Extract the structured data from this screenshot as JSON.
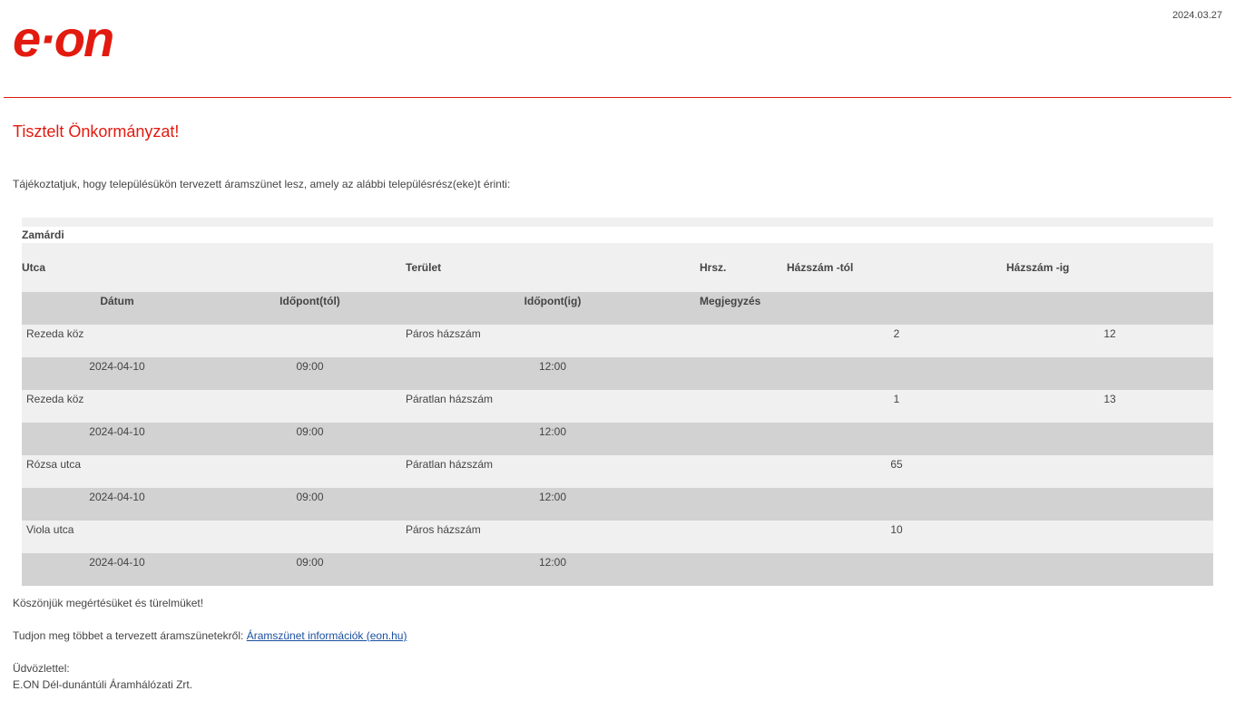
{
  "brand": {
    "logo_text": "e·on",
    "accent_color": "#e31a0f"
  },
  "date": "2024.03.27",
  "greeting": "Tisztelt Önkormányzat!",
  "intro": "Tájékoztatjuk, hogy településükön tervezett áramszünet lesz, amely az alábbi településrész(eke)t érinti:",
  "table": {
    "settlement": "Zamárdi",
    "headers_row1": {
      "utca": "Utca",
      "terulet": "Terület",
      "hrsz": "Hrsz.",
      "hazszam_tol": "Házszám -tól",
      "hazszam_ig": "Házszám -ig"
    },
    "headers_row2": {
      "datum": "Dátum",
      "idopont_tol": "Időpont(tól)",
      "idopont_ig": "Időpont(ig)",
      "megjegyzes": "Megjegyzés"
    },
    "rows": [
      {
        "utca": "Rezeda köz",
        "terulet": "Páros házszám",
        "hrsz": "",
        "tol": "2",
        "ig": "12",
        "datum": "2024-04-10",
        "time_from": "09:00",
        "time_to": "12:00",
        "megjegyzes": ""
      },
      {
        "utca": "Rezeda köz",
        "terulet": "Páratlan házszám",
        "hrsz": "",
        "tol": "1",
        "ig": "13",
        "datum": "2024-04-10",
        "time_from": "09:00",
        "time_to": "12:00",
        "megjegyzes": ""
      },
      {
        "utca": "Rózsa utca",
        "terulet": "Páratlan házszám",
        "hrsz": "",
        "tol": "65",
        "ig": "",
        "datum": "2024-04-10",
        "time_from": "09:00",
        "time_to": "12:00",
        "megjegyzes": ""
      },
      {
        "utca": "Viola utca",
        "terulet": "Páros házszám",
        "hrsz": "",
        "tol": "10",
        "ig": "",
        "datum": "2024-04-10",
        "time_from": "09:00",
        "time_to": "12:00",
        "megjegyzes": ""
      }
    ]
  },
  "footer": {
    "thanks": "Köszönjük megértésüket és türelmüket!",
    "more_info_prefix": "Tudjon meg többet a tervezett áramszünetekről: ",
    "more_info_link": "Áramszünet információk (eon.hu)",
    "closing": "Üdvözlettel:",
    "company": "E.ON Dél-dunántúli Áramhálózati Zrt."
  }
}
